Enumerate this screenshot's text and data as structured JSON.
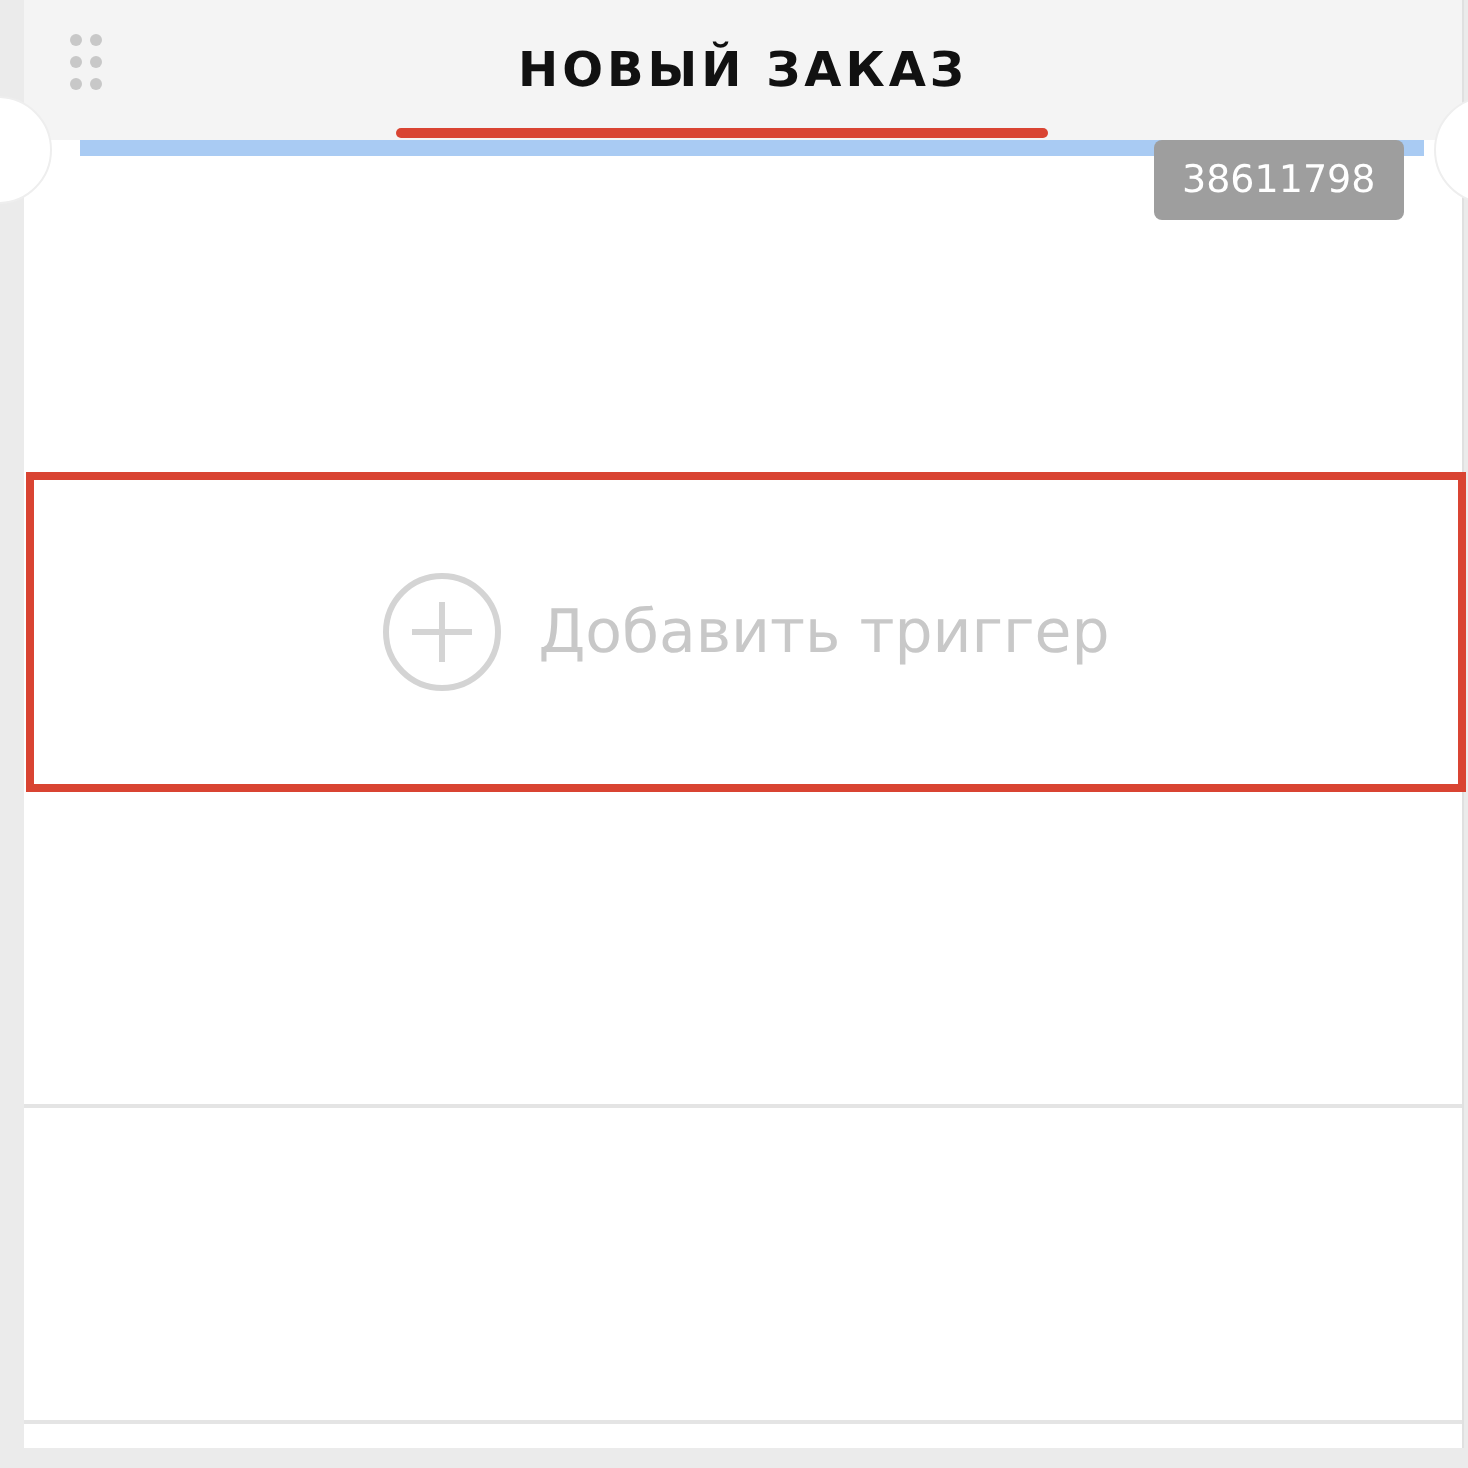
{
  "header": {
    "title": "НОВЫЙ ЗАКАЗ"
  },
  "order_id": "38611798",
  "add_trigger": {
    "label": "Добавить триггер"
  }
}
